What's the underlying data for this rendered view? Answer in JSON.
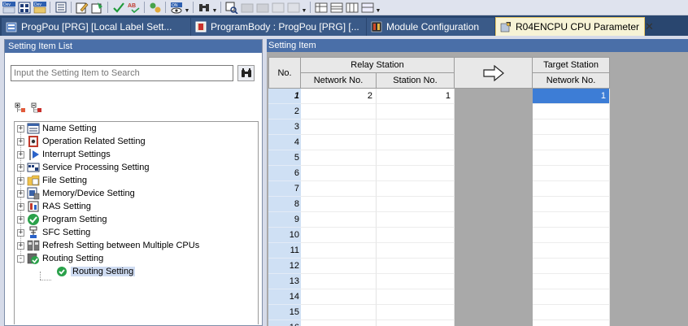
{
  "toolbar": {
    "buttons": [
      "dev-icon",
      "grid-dev-icon",
      "dev-icon",
      "list-icon",
      "edit-icon",
      "compile-icon",
      "check-icon",
      "spell-check-icon",
      "build-icon",
      "monitor-icon",
      "binoculars-icon",
      "zoom-icon",
      "device-icon",
      "device-icon",
      "layout-icon",
      "layout-icon",
      "table-icon",
      "table-icon"
    ]
  },
  "tabs": [
    {
      "label": "ProgPou [PRG] [Local Label Sett...",
      "icon": "local-label-icon",
      "active": false
    },
    {
      "label": "ProgramBody : ProgPou [PRG] [...",
      "icon": "program-icon",
      "active": false
    },
    {
      "label": "Module Configuration",
      "icon": "module-config-icon",
      "active": false
    },
    {
      "label": "R04ENCPU CPU Parameter",
      "icon": "cpu-parameter-icon",
      "active": true,
      "close": "✕"
    }
  ],
  "left_panel": {
    "title": "Setting Item List",
    "search_placeholder": "Input the Setting Item to Search",
    "tree": [
      {
        "label": "Name Setting",
        "icon": "name-setting-icon",
        "expander": "+"
      },
      {
        "label": "Operation Related Setting",
        "icon": "operation-setting-icon",
        "expander": "+"
      },
      {
        "label": "Interrupt Settings",
        "icon": "interrupt-icon",
        "expander": "+"
      },
      {
        "label": "Service Processing Setting",
        "icon": "service-processing-icon",
        "expander": "+"
      },
      {
        "label": "File Setting",
        "icon": "file-setting-icon",
        "expander": "+"
      },
      {
        "label": "Memory/Device Setting",
        "icon": "memory-device-icon",
        "expander": "+"
      },
      {
        "label": "RAS Setting",
        "icon": "ras-setting-icon",
        "expander": "+"
      },
      {
        "label": "Program Setting",
        "icon": "program-setting-icon",
        "expander": "+"
      },
      {
        "label": "SFC Setting",
        "icon": "sfc-setting-icon",
        "expander": "+"
      },
      {
        "label": "Refresh Setting between Multiple CPUs",
        "icon": "refresh-setting-icon",
        "expander": "+"
      },
      {
        "label": "Routing Setting",
        "icon": "routing-setting-icon",
        "expander": "-"
      },
      {
        "label": "Routing Setting",
        "icon": "check-circle-icon",
        "child": true,
        "selected": true
      }
    ]
  },
  "right_panel": {
    "title": "Setting Item",
    "headers": {
      "no": "No.",
      "relay_station": "Relay Station",
      "network_no": "Network No.",
      "station_no": "Station No.",
      "arrow": "⇨",
      "target_station": "Target Station",
      "target_network_no": "Network No."
    },
    "rows": [
      {
        "no": "1",
        "relay_network_no": "2",
        "relay_station_no": "1",
        "target_network_no": "1"
      },
      {
        "no": "2",
        "relay_network_no": "",
        "relay_station_no": "",
        "target_network_no": ""
      },
      {
        "no": "3",
        "relay_network_no": "",
        "relay_station_no": "",
        "target_network_no": ""
      },
      {
        "no": "4",
        "relay_network_no": "",
        "relay_station_no": "",
        "target_network_no": ""
      },
      {
        "no": "5",
        "relay_network_no": "",
        "relay_station_no": "",
        "target_network_no": ""
      },
      {
        "no": "6",
        "relay_network_no": "",
        "relay_station_no": "",
        "target_network_no": ""
      },
      {
        "no": "7",
        "relay_network_no": "",
        "relay_station_no": "",
        "target_network_no": ""
      },
      {
        "no": "8",
        "relay_network_no": "",
        "relay_station_no": "",
        "target_network_no": ""
      },
      {
        "no": "9",
        "relay_network_no": "",
        "relay_station_no": "",
        "target_network_no": ""
      },
      {
        "no": "10",
        "relay_network_no": "",
        "relay_station_no": "",
        "target_network_no": ""
      },
      {
        "no": "11",
        "relay_network_no": "",
        "relay_station_no": "",
        "target_network_no": ""
      },
      {
        "no": "12",
        "relay_network_no": "",
        "relay_station_no": "",
        "target_network_no": ""
      },
      {
        "no": "13",
        "relay_network_no": "",
        "relay_station_no": "",
        "target_network_no": ""
      },
      {
        "no": "14",
        "relay_network_no": "",
        "relay_station_no": "",
        "target_network_no": ""
      },
      {
        "no": "15",
        "relay_network_no": "",
        "relay_station_no": "",
        "target_network_no": ""
      },
      {
        "no": "16",
        "relay_network_no": "",
        "relay_station_no": "",
        "target_network_no": ""
      }
    ]
  },
  "colors": {
    "tab_bar": "#29466f",
    "active_tab": "#f7f3d6",
    "panel_title": "#4a6fa8",
    "row_header": "#cfe0f4",
    "selected_cell": "#3d7dd6",
    "empty_area": "#a9a9a9"
  }
}
